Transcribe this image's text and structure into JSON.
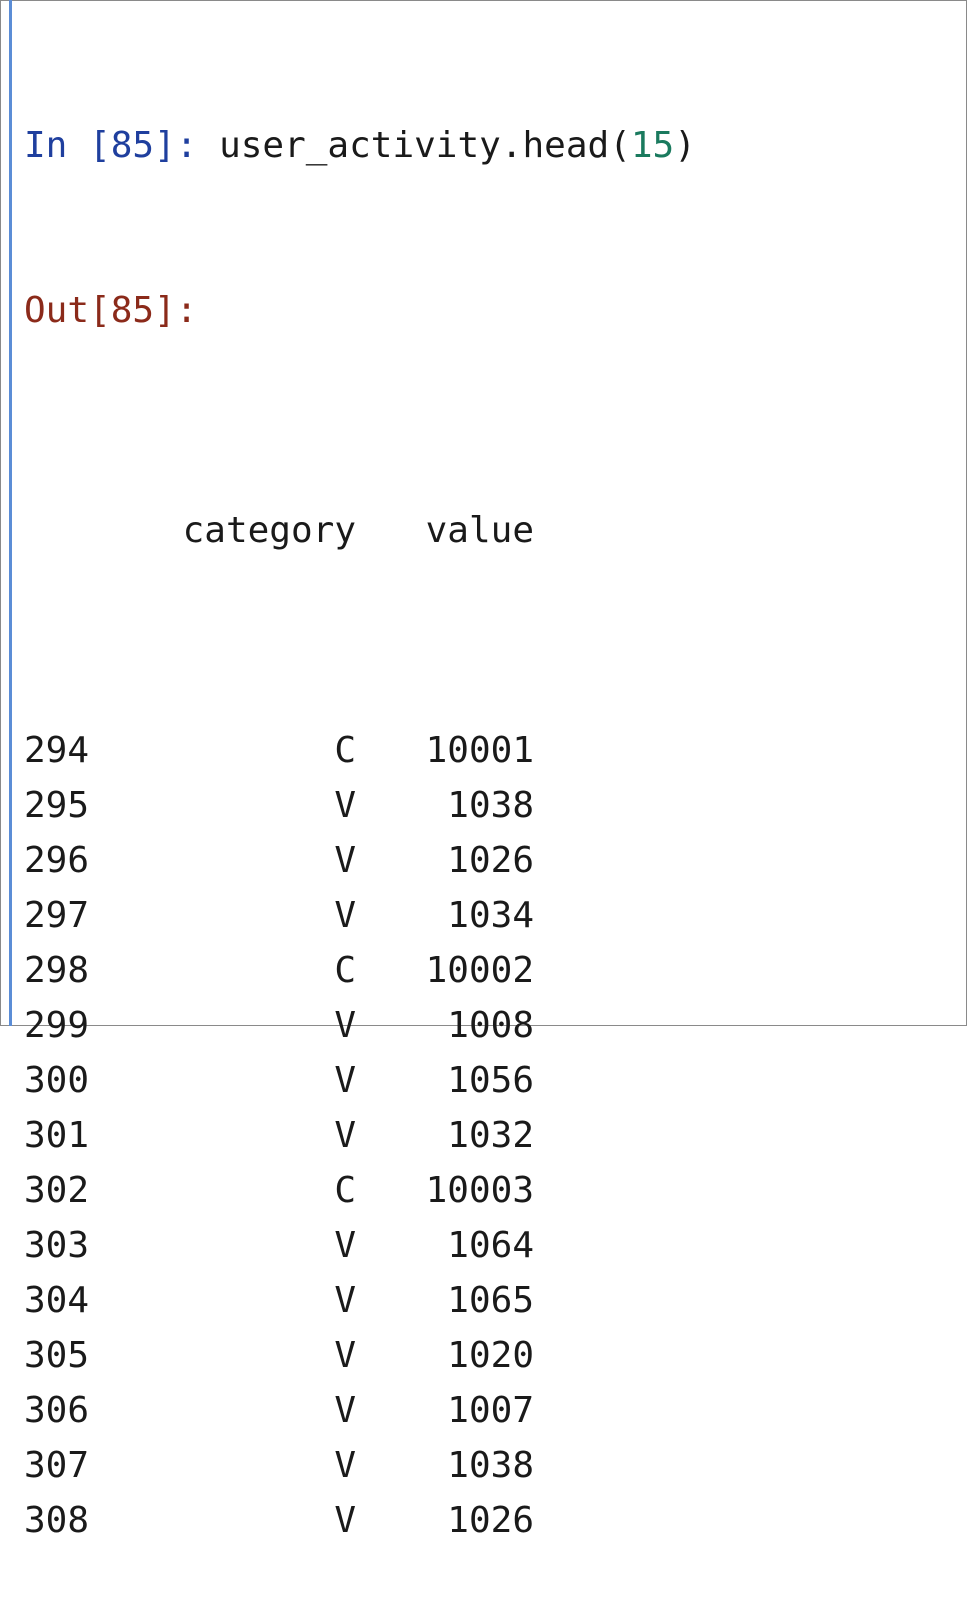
{
  "input": {
    "prompt": "In [85]:",
    "code_prefix": " user_activity.head(",
    "code_arg": "15",
    "code_suffix": ")"
  },
  "output": {
    "prompt": "Out[85]:"
  },
  "table": {
    "columns": [
      "category",
      "value"
    ],
    "rows": [
      {
        "index": "294",
        "category": "C",
        "value": "10001"
      },
      {
        "index": "295",
        "category": "V",
        "value": "1038"
      },
      {
        "index": "296",
        "category": "V",
        "value": "1026"
      },
      {
        "index": "297",
        "category": "V",
        "value": "1034"
      },
      {
        "index": "298",
        "category": "C",
        "value": "10002"
      },
      {
        "index": "299",
        "category": "V",
        "value": "1008"
      },
      {
        "index": "300",
        "category": "V",
        "value": "1056"
      },
      {
        "index": "301",
        "category": "V",
        "value": "1032"
      },
      {
        "index": "302",
        "category": "C",
        "value": "10003"
      },
      {
        "index": "303",
        "category": "V",
        "value": "1064"
      },
      {
        "index": "304",
        "category": "V",
        "value": "1065"
      },
      {
        "index": "305",
        "category": "V",
        "value": "1020"
      },
      {
        "index": "306",
        "category": "V",
        "value": "1007"
      },
      {
        "index": "307",
        "category": "V",
        "value": "1038"
      },
      {
        "index": "308",
        "category": "V",
        "value": "1026"
      }
    ]
  },
  "colors": {
    "in_prompt": "#1f3f9e",
    "out_prompt": "#8b2a1a",
    "number_literal": "#1a7a5e",
    "gutter": "#5b8dd6"
  }
}
